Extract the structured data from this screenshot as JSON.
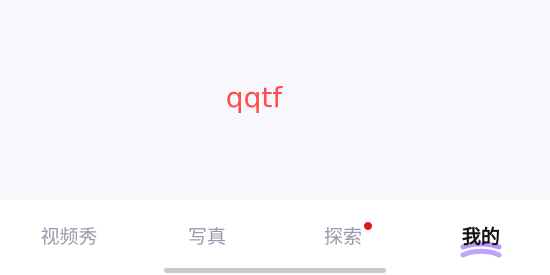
{
  "content": {
    "text": "qqtf"
  },
  "tabs": [
    {
      "label": "视频秀",
      "active": false,
      "badge": false
    },
    {
      "label": "写真",
      "active": false,
      "badge": false
    },
    {
      "label": "探索",
      "active": false,
      "badge": true
    },
    {
      "label": "我的",
      "active": true,
      "badge": false
    }
  ],
  "colors": {
    "content_text": "#ff4d4f",
    "tab_inactive": "#9b98ad",
    "tab_active": "#111111",
    "badge": "#e21818",
    "active_accent": "#b08cff",
    "background": "#f8f7fc"
  }
}
